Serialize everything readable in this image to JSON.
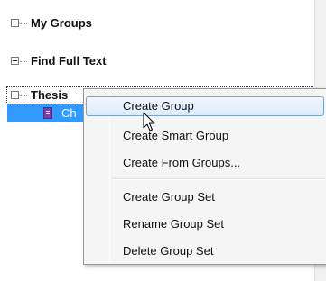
{
  "tree": {
    "groups": [
      {
        "label": "My Groups"
      },
      {
        "label": "Find Full Text"
      },
      {
        "label": "Thesis"
      }
    ],
    "selected_child": {
      "label": "Ch",
      "icon": "notebook-icon"
    }
  },
  "context_menu": {
    "items": [
      {
        "label": "Create Group",
        "hovered": true
      },
      {
        "label": "Create Smart Group"
      },
      {
        "label": "Create From Groups..."
      },
      {
        "label": "Create Group Set"
      },
      {
        "label": "Rename Group Set"
      },
      {
        "label": "Delete Group Set"
      }
    ]
  },
  "colors": {
    "selection": "#3399ff",
    "menu_hover_border": "#7da2ce",
    "menu_background": "#f5f5f5"
  },
  "icons": {
    "expander": "collapse-minus-icon",
    "cursor": "arrow-pointer-icon"
  }
}
